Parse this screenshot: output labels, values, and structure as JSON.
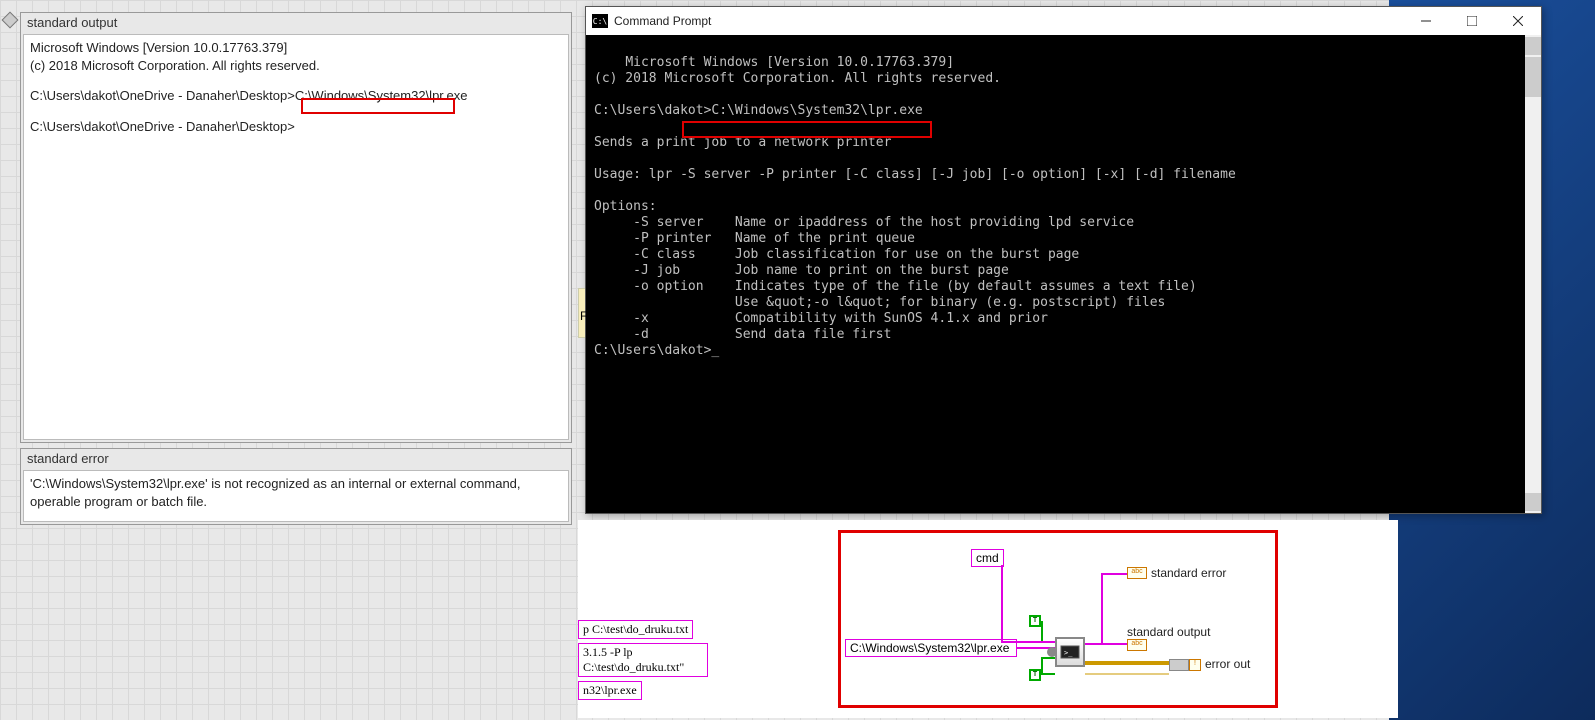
{
  "stdout": {
    "title": "standard output",
    "line1": "Microsoft Windows [Version 10.0.17763.379]",
    "line2": "(c) 2018 Microsoft Corporation. All rights reserved.",
    "line3a": "C:\\Users\\dakot\\OneDrive - Danaher\\Desktop>",
    "line3b": "C:\\Windows\\System32\\lpr.exe",
    "line4": "C:\\Users\\dakot\\OneDrive - Danaher\\Desktop>"
  },
  "stderr": {
    "title": "standard error",
    "text": "'C:\\Windows\\System32\\lpr.exe' is not recognized as an internal or external command,\noperable program or batch file."
  },
  "cmd": {
    "icon_text": "C:\\",
    "title": "Command Prompt",
    "body": "Microsoft Windows [Version 10.0.17763.379]\n(c) 2018 Microsoft Corporation. All rights reserved.\n\nC:\\Users\\dakot>C:\\Windows\\System32\\lpr.exe\n\nSends a print job to a network printer\n\nUsage: lpr -S server -P printer [-C class] [-J job] [-o option] [-x] [-d] filename\n\nOptions:\n     -S server    Name or ipaddress of the host providing lpd service\n     -P printer   Name of the print queue\n     -C class     Job classification for use on the burst page\n     -J job       Job name to print on the burst page\n     -o option    Indicates type of the file (by default assumes a text file)\n                  Use &quot;-o l&quot; for binary (e.g. postscript) files\n     -x           Compatibility with SunOS 4.1.x and prior\n     -d           Send data file first\nC:\\Users\\dakot>_"
  },
  "diagram": {
    "cmd_label": "cmd",
    "const_string": "C:\\Windows\\System32\\lpr.exe",
    "out_stderr": "standard error",
    "out_stdout": "standard output",
    "out_errout": "error out"
  },
  "snippets": {
    "a": "p C:\\test\\do_druku.txt",
    "b": "3.1.5 -P lp C:\\test\\do_druku.txt\"",
    "c": "n32\\lpr.exe"
  }
}
